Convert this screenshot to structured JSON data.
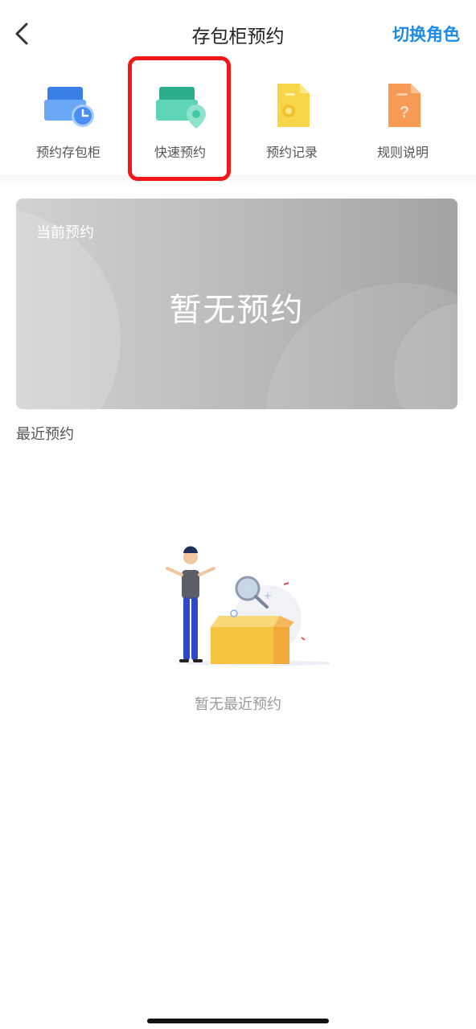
{
  "header": {
    "title": "存包柜预约",
    "right_action": "切换角色",
    "back_icon": "chevron-left-icon",
    "accent_color": "#1c8be8"
  },
  "menu": {
    "items": [
      {
        "label": "预约存包柜",
        "icon": "locker-clock-icon",
        "color": "#4a8ff0"
      },
      {
        "label": "快速预约",
        "icon": "locker-location-icon",
        "color": "#3ec9a7"
      },
      {
        "label": "预约记录",
        "icon": "record-document-icon",
        "color": "#f5c93a"
      },
      {
        "label": "规则说明",
        "icon": "help-document-icon",
        "color": "#f79a56"
      }
    ],
    "highlight_color": "#f01818"
  },
  "current": {
    "label": "当前预约",
    "empty_text": "暂无预约"
  },
  "recent": {
    "label": "最近预约",
    "empty_text": "暂无最近预约",
    "illustration": "empty-box-person-illustration"
  }
}
